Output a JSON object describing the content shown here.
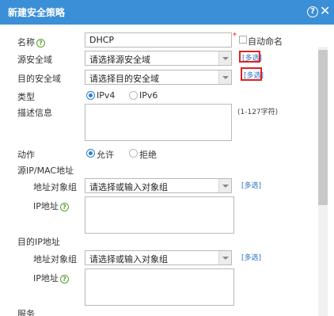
{
  "dialog": {
    "title": "新建安全策略",
    "help_glyph": "?",
    "close_glyph": "✕"
  },
  "form": {
    "name": {
      "label": "名称",
      "value": "DHCP",
      "required_mark": "*",
      "auto_name_label": "自动命名"
    },
    "src_zone": {
      "label": "源安全域",
      "placeholder": "请选择源安全域",
      "multi_label": "[多选]"
    },
    "dst_zone": {
      "label": "目的安全域",
      "placeholder": "请选择目的安全域",
      "multi_label": "[多选]"
    },
    "type": {
      "label": "类型",
      "options": [
        "IPv4",
        "IPv6"
      ],
      "selected": "IPv4"
    },
    "description": {
      "label": "描述信息",
      "hint": "(1-127字符)"
    },
    "action": {
      "label": "动作",
      "options": [
        "允许",
        "拒绝"
      ],
      "selected": "允许"
    },
    "src_addr": {
      "section_label": "源IP/MAC地址",
      "obj_group_label": "地址对象组",
      "obj_group_placeholder": "请选择或输入对象组",
      "multi_label": "[多选]",
      "ip_label": "IP地址"
    },
    "dst_addr": {
      "section_label": "目的IP地址",
      "obj_group_label": "地址对象组",
      "obj_group_placeholder": "请选择或输入对象组",
      "multi_label": "[多选]",
      "ip_label": "IP地址"
    },
    "service": {
      "section_label": "服务"
    }
  },
  "colors": {
    "titlebar": "#3b8fd6",
    "highlight": "#e02020",
    "link": "#2a6fc0",
    "help_green": "#5aa02c"
  }
}
